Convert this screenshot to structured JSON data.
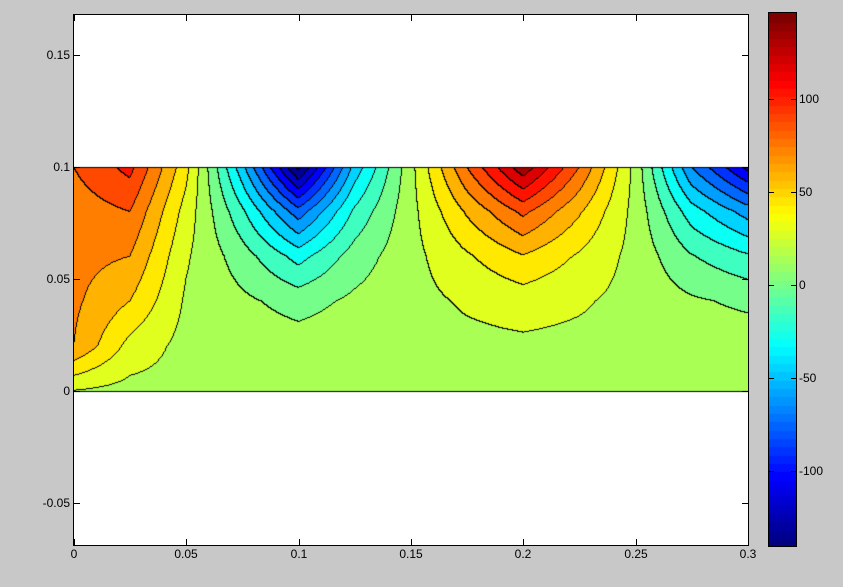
{
  "chart_data": {
    "type": "heatmap",
    "subtype": "filled-contour",
    "title": "",
    "xlabel": "",
    "ylabel": "",
    "xlim": [
      0,
      0.3
    ],
    "ylim": [
      -0.069,
      0.168
    ],
    "x_ticks": [
      "0",
      "0.05",
      "0.1",
      "0.15",
      "0.2",
      "0.25",
      "0.3"
    ],
    "x_tick_values": [
      0,
      0.05,
      0.1,
      0.15,
      0.2,
      0.25,
      0.3
    ],
    "y_ticks": [
      "-0.05",
      "0",
      "0.05",
      "0.1",
      "0.15"
    ],
    "y_tick_values": [
      -0.05,
      0,
      0.05,
      0.1,
      0.15
    ],
    "colormap": "jet",
    "clim": [
      -140,
      146
    ],
    "colorbar": {
      "ticks": [
        "-100",
        "-50",
        "0",
        "50",
        "100"
      ],
      "tick_values": [
        -100,
        -50,
        0,
        50,
        100
      ],
      "location": "right"
    },
    "contour_levels": [
      -135,
      -120,
      -105,
      -90,
      -75,
      -60,
      -45,
      -30,
      -15,
      0,
      15,
      30,
      45,
      60,
      75,
      90,
      105,
      120,
      135
    ],
    "grid_x": [
      0,
      0.025,
      0.05,
      0.075,
      0.1,
      0.125,
      0.15,
      0.175,
      0.2,
      0.225,
      0.25,
      0.275,
      0.3
    ],
    "grid_y": [
      0,
      0.02,
      0.04,
      0.06,
      0.08,
      0.1
    ],
    "z": [
      [
        30,
        25,
        25,
        25,
        25,
        25,
        25,
        25,
        25,
        25,
        25,
        25,
        25
      ],
      [
        75,
        40,
        25,
        24,
        22,
        24,
        25,
        26,
        27,
        26,
        25,
        23,
        23
      ],
      [
        78,
        60,
        28,
        18,
        9,
        18,
        25,
        32,
        37,
        32,
        25,
        17,
        12
      ],
      [
        80,
        75,
        32,
        7,
        -21,
        7,
        25,
        43,
        59,
        43,
        25,
        1,
        -13
      ],
      [
        82,
        90,
        39,
        -12,
        -69,
        -12,
        25,
        62,
        94,
        62,
        25,
        -23,
        -52
      ],
      [
        90,
        110,
        50,
        -40,
        -140,
        -40,
        25,
        90,
        146,
        90,
        25,
        -60,
        -110
      ]
    ]
  }
}
